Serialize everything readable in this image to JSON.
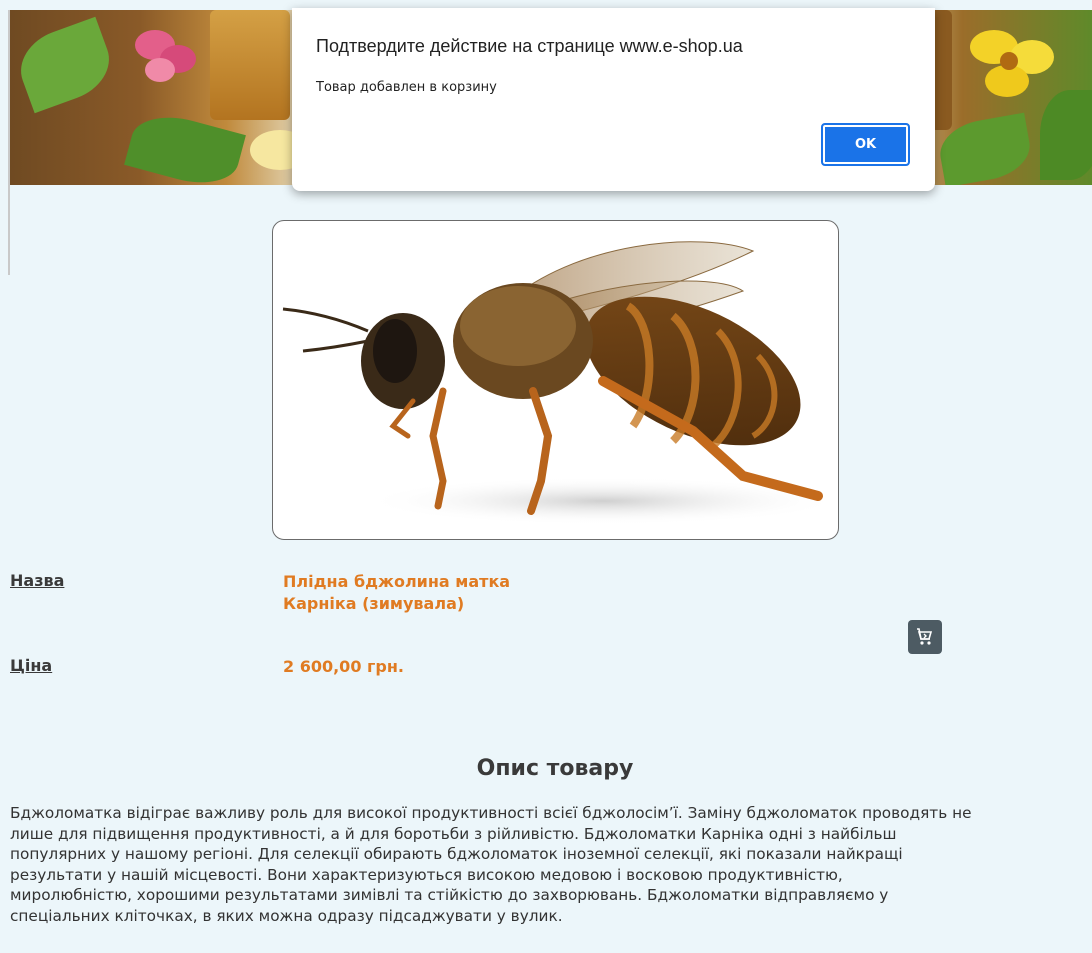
{
  "dialog": {
    "title": "Подтвердите действие на странице www.e-shop.ua",
    "message": "Товар добавлен в корзину",
    "ok_label": "OK"
  },
  "product": {
    "name_label": "Назва",
    "name_line1": "Плідна бджолина матка",
    "name_line2": "Карніка (зимувала)",
    "price_label": "Ціна",
    "price_value": "2 600,00 грн.",
    "cart_icon": "add-to-cart-icon"
  },
  "description": {
    "title": "Опис товару",
    "text": "Бджоломатка відіграє важливу роль для високої продуктивності всієї бджолосім’ї. Заміну бджоломаток проводять не\nлише для підвищення продуктивності, а й для боротьби з рійливістю. Бджоломатки Карніка одні з найбільш\nпопулярних у нашому регіоні. Для селекції обирають бджоломаток іноземної селекції, які показали найкращі\nрезультати у нашій місцевості. Вони характеризуються високою медовою і восковою продуктивністю,\nмиролюбністю, хорошими результатами зимівлі та стійкістю до захворювань. Бджоломатки відправляємо у\nспеціальних кліточках, в яких можна одразу підсаджувати у вулик."
  },
  "colors": {
    "accent": "#e07b22",
    "ok_button": "#1a73e8",
    "background": "#ecf6fa"
  }
}
